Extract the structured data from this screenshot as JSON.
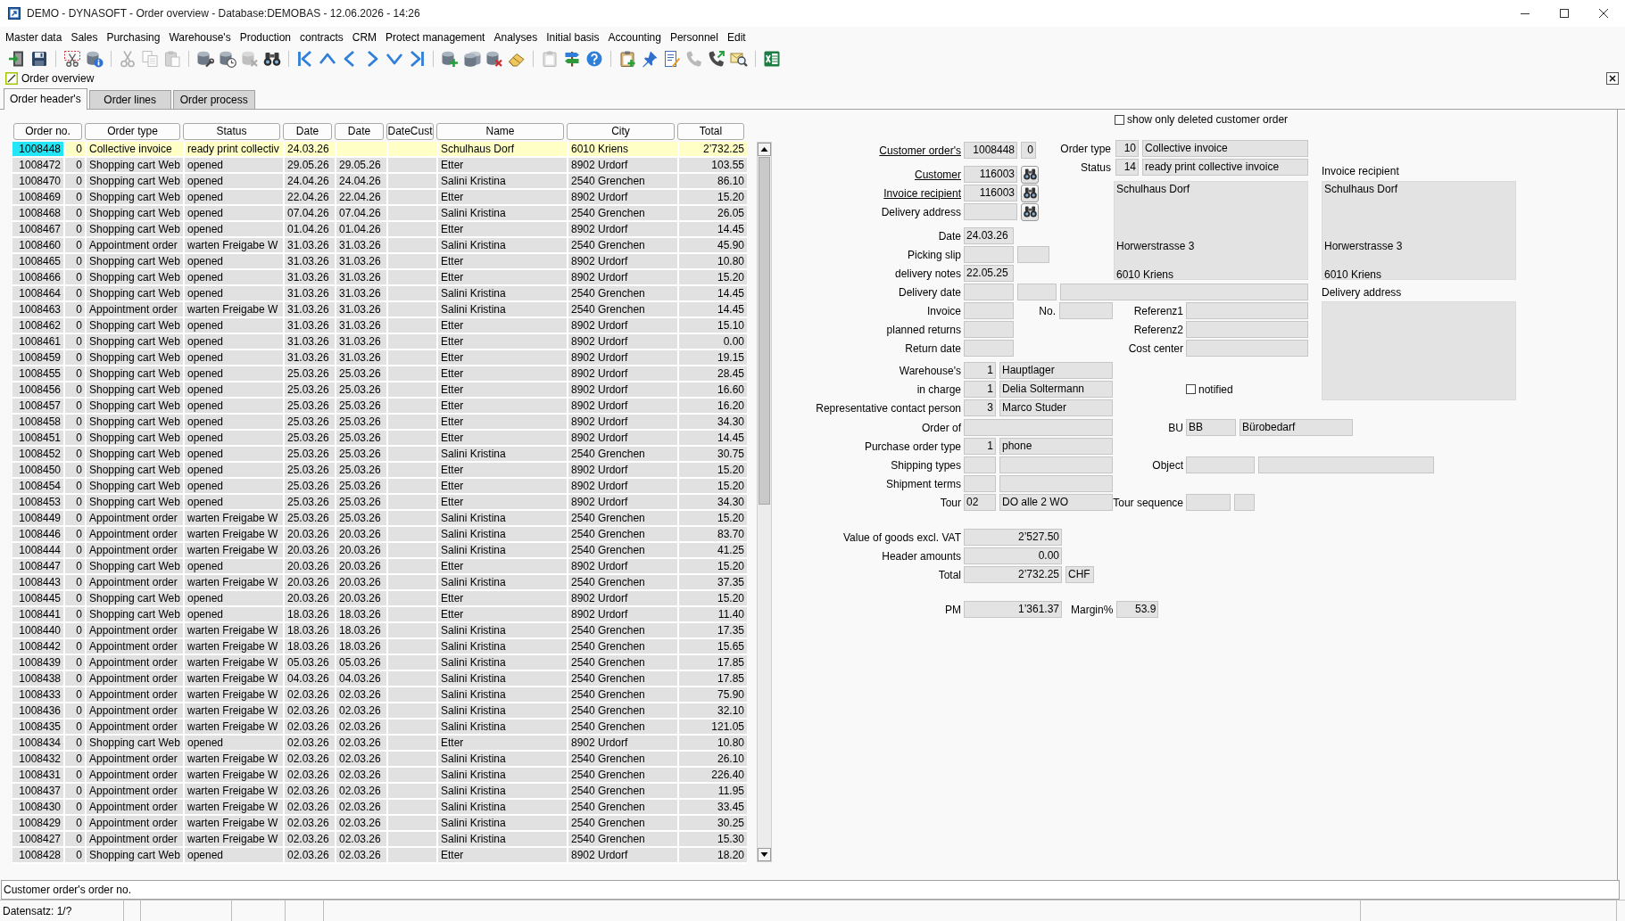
{
  "window": {
    "title": "DEMO - DYNASOFT - Order overview - Database:DEMOBAS - 12.06.2026 - 14:26"
  },
  "menu": [
    "Master data",
    "Sales",
    "Purchasing",
    "Warehouse's",
    "Production",
    "contracts",
    "CRM",
    "Protect management",
    "Analyses",
    "Initial basis",
    "Accounting",
    "Personnel",
    "Edit"
  ],
  "toolbar": {
    "groups": [
      {
        "buttons": [
          {
            "kind": "exit",
            "disabled": false
          },
          {
            "kind": "save",
            "disabled": false
          }
        ]
      },
      {
        "buttons": [
          {
            "kind": "cutframe",
            "disabled": false
          },
          {
            "kind": "dbinfo",
            "disabled": false
          }
        ]
      },
      {
        "buttons": [
          {
            "kind": "cut",
            "disabled": true
          },
          {
            "kind": "copy",
            "disabled": true
          },
          {
            "kind": "paste",
            "disabled": true
          }
        ]
      },
      {
        "buttons": [
          {
            "kind": "dbtools",
            "disabled": false
          },
          {
            "kind": "dbclock",
            "disabled": false
          },
          {
            "kind": "dbdelete",
            "disabled": true
          },
          {
            "kind": "binoculars",
            "disabled": false
          }
        ]
      },
      {
        "buttons": [
          {
            "kind": "first",
            "disabled": false
          },
          {
            "kind": "up",
            "disabled": false
          },
          {
            "kind": "left",
            "disabled": false
          },
          {
            "kind": "right",
            "disabled": false
          },
          {
            "kind": "down",
            "disabled": false
          },
          {
            "kind": "last",
            "disabled": false
          }
        ]
      },
      {
        "buttons": [
          {
            "kind": "dbadd",
            "disabled": false
          },
          {
            "kind": "dbstack",
            "disabled": false
          },
          {
            "kind": "dbdelete",
            "disabled": false
          },
          {
            "kind": "eraser",
            "disabled": false
          }
        ]
      },
      {
        "buttons": [
          {
            "kind": "clipboard",
            "disabled": true
          },
          {
            "kind": "signpost",
            "disabled": false
          },
          {
            "kind": "help",
            "disabled": false
          }
        ]
      },
      {
        "buttons": [
          {
            "kind": "clipboardadd",
            "disabled": false
          },
          {
            "kind": "pin",
            "disabled": false
          },
          {
            "kind": "notepad",
            "disabled": false
          },
          {
            "kind": "phone",
            "disabled": true
          },
          {
            "kind": "call",
            "disabled": false
          },
          {
            "kind": "search",
            "disabled": false
          }
        ]
      },
      {
        "buttons": [
          {
            "kind": "spreadsheet",
            "disabled": false
          }
        ]
      }
    ]
  },
  "document": {
    "title": "Order overview"
  },
  "tabs": [
    {
      "label": "Order header's",
      "selected": true
    },
    {
      "label": "Order lines",
      "selected": false
    },
    {
      "label": "Order process",
      "selected": false
    }
  ],
  "table": {
    "columns": [
      "Order no.",
      "Order type",
      "Status",
      "Date",
      "Date",
      "DateCust",
      "Name",
      "City",
      "Total"
    ],
    "rows": [
      {
        "order_no": "1008448",
        "column_2": "0",
        "order_type": "Collective invoice",
        "status": "ready print collectiv",
        "date": "24.03.26",
        "name": "Schulhaus Dorf",
        "city": "6010 Kriens",
        "total": "2’732.25",
        "selected": true
      },
      {
        "order_no": "1008472",
        "column_2": "0",
        "order_type": "Shopping cart Web",
        "status": "opened",
        "date": "29.05.26",
        "date_2": "29.05.26",
        "name": "Etter",
        "city": "8902 Urdorf",
        "total": "103.55",
        "selected": false
      },
      {
        "order_no": "1008470",
        "column_2": "0",
        "order_type": "Shopping cart Web",
        "status": "opened",
        "date": "24.04.26",
        "date_2": "24.04.26",
        "name": "Salini Kristina",
        "city": "2540 Grenchen",
        "total": "86.10",
        "selected": false
      },
      {
        "order_no": "1008469",
        "column_2": "0",
        "order_type": "Shopping cart Web",
        "status": "opened",
        "date": "22.04.26",
        "date_2": "22.04.26",
        "name": "Etter",
        "city": "8902 Urdorf",
        "total": "15.20",
        "selected": false
      },
      {
        "order_no": "1008468",
        "column_2": "0",
        "order_type": "Shopping cart Web",
        "status": "opened",
        "date": "07.04.26",
        "date_2": "07.04.26",
        "name": "Salini Kristina",
        "city": "2540 Grenchen",
        "total": "26.05",
        "selected": false
      },
      {
        "order_no": "1008467",
        "column_2": "0",
        "order_type": "Shopping cart Web",
        "status": "opened",
        "date": "01.04.26",
        "date_2": "01.04.26",
        "name": "Etter",
        "city": "8902 Urdorf",
        "total": "14.45",
        "selected": false
      },
      {
        "order_no": "1008460",
        "column_2": "0",
        "order_type": "Appointment order",
        "status": "warten Freigabe W",
        "date": "31.03.26",
        "date_2": "31.03.26",
        "name": "Salini Kristina",
        "city": "2540 Grenchen",
        "total": "45.90",
        "selected": false
      },
      {
        "order_no": "1008465",
        "column_2": "0",
        "order_type": "Shopping cart Web",
        "status": "opened",
        "date": "31.03.26",
        "date_2": "31.03.26",
        "name": "Etter",
        "city": "8902 Urdorf",
        "total": "10.80",
        "selected": false
      },
      {
        "order_no": "1008466",
        "column_2": "0",
        "order_type": "Shopping cart Web",
        "status": "opened",
        "date": "31.03.26",
        "date_2": "31.03.26",
        "name": "Etter",
        "city": "8902 Urdorf",
        "total": "15.20",
        "selected": false
      },
      {
        "order_no": "1008464",
        "column_2": "0",
        "order_type": "Shopping cart Web",
        "status": "opened",
        "date": "31.03.26",
        "date_2": "31.03.26",
        "name": "Salini Kristina",
        "city": "2540 Grenchen",
        "total": "14.45",
        "selected": false
      },
      {
        "order_no": "1008463",
        "column_2": "0",
        "order_type": "Appointment order",
        "status": "warten Freigabe W",
        "date": "31.03.26",
        "date_2": "31.03.26",
        "name": "Salini Kristina",
        "city": "2540 Grenchen",
        "total": "14.45",
        "selected": false
      },
      {
        "order_no": "1008462",
        "column_2": "0",
        "order_type": "Shopping cart Web",
        "status": "opened",
        "date": "31.03.26",
        "date_2": "31.03.26",
        "name": "Etter",
        "city": "8902 Urdorf",
        "total": "15.10",
        "selected": false
      },
      {
        "order_no": "1008461",
        "column_2": "0",
        "order_type": "Shopping cart Web",
        "status": "opened",
        "date": "31.03.26",
        "date_2": "31.03.26",
        "name": "Etter",
        "city": "8902 Urdorf",
        "total": "0.00",
        "selected": false
      },
      {
        "order_no": "1008459",
        "column_2": "0",
        "order_type": "Shopping cart Web",
        "status": "opened",
        "date": "31.03.26",
        "date_2": "31.03.26",
        "name": "Etter",
        "city": "8902 Urdorf",
        "total": "19.15",
        "selected": false
      },
      {
        "order_no": "1008455",
        "column_2": "0",
        "order_type": "Shopping cart Web",
        "status": "opened",
        "date": "25.03.26",
        "date_2": "25.03.26",
        "name": "Etter",
        "city": "8902 Urdorf",
        "total": "28.45",
        "selected": false
      },
      {
        "order_no": "1008456",
        "column_2": "0",
        "order_type": "Shopping cart Web",
        "status": "opened",
        "date": "25.03.26",
        "date_2": "25.03.26",
        "name": "Etter",
        "city": "8902 Urdorf",
        "total": "16.60",
        "selected": false
      },
      {
        "order_no": "1008457",
        "column_2": "0",
        "order_type": "Shopping cart Web",
        "status": "opened",
        "date": "25.03.26",
        "date_2": "25.03.26",
        "name": "Etter",
        "city": "8902 Urdorf",
        "total": "16.20",
        "selected": false
      },
      {
        "order_no": "1008458",
        "column_2": "0",
        "order_type": "Shopping cart Web",
        "status": "opened",
        "date": "25.03.26",
        "date_2": "25.03.26",
        "name": "Etter",
        "city": "8902 Urdorf",
        "total": "34.30",
        "selected": false
      },
      {
        "order_no": "1008451",
        "column_2": "0",
        "order_type": "Shopping cart Web",
        "status": "opened",
        "date": "25.03.26",
        "date_2": "25.03.26",
        "name": "Etter",
        "city": "8902 Urdorf",
        "total": "14.45",
        "selected": false
      },
      {
        "order_no": "1008452",
        "column_2": "0",
        "order_type": "Shopping cart Web",
        "status": "opened",
        "date": "25.03.26",
        "date_2": "25.03.26",
        "name": "Salini Kristina",
        "city": "2540 Grenchen",
        "total": "30.75",
        "selected": false
      },
      {
        "order_no": "1008450",
        "column_2": "0",
        "order_type": "Shopping cart Web",
        "status": "opened",
        "date": "25.03.26",
        "date_2": "25.03.26",
        "name": "Etter",
        "city": "8902 Urdorf",
        "total": "15.20",
        "selected": false
      },
      {
        "order_no": "1008454",
        "column_2": "0",
        "order_type": "Shopping cart Web",
        "status": "opened",
        "date": "25.03.26",
        "date_2": "25.03.26",
        "name": "Etter",
        "city": "8902 Urdorf",
        "total": "15.20",
        "selected": false
      },
      {
        "order_no": "1008453",
        "column_2": "0",
        "order_type": "Shopping cart Web",
        "status": "opened",
        "date": "25.03.26",
        "date_2": "25.03.26",
        "name": "Etter",
        "city": "8902 Urdorf",
        "total": "34.30",
        "selected": false
      },
      {
        "order_no": "1008449",
        "column_2": "0",
        "order_type": "Appointment order",
        "status": "warten Freigabe W",
        "date": "25.03.26",
        "date_2": "25.03.26",
        "name": "Salini Kristina",
        "city": "2540 Grenchen",
        "total": "15.20",
        "selected": false
      },
      {
        "order_no": "1008446",
        "column_2": "0",
        "order_type": "Appointment order",
        "status": "warten Freigabe W",
        "date": "20.03.26",
        "date_2": "20.03.26",
        "name": "Salini Kristina",
        "city": "2540 Grenchen",
        "total": "83.70",
        "selected": false
      },
      {
        "order_no": "1008444",
        "column_2": "0",
        "order_type": "Appointment order",
        "status": "warten Freigabe W",
        "date": "20.03.26",
        "date_2": "20.03.26",
        "name": "Salini Kristina",
        "city": "2540 Grenchen",
        "total": "41.25",
        "selected": false
      },
      {
        "order_no": "1008447",
        "column_2": "0",
        "order_type": "Shopping cart Web",
        "status": "opened",
        "date": "20.03.26",
        "date_2": "20.03.26",
        "name": "Etter",
        "city": "8902 Urdorf",
        "total": "15.20",
        "selected": false
      },
      {
        "order_no": "1008443",
        "column_2": "0",
        "order_type": "Appointment order",
        "status": "warten Freigabe W",
        "date": "20.03.26",
        "date_2": "20.03.26",
        "name": "Salini Kristina",
        "city": "2540 Grenchen",
        "total": "37.35",
        "selected": false
      },
      {
        "order_no": "1008445",
        "column_2": "0",
        "order_type": "Shopping cart Web",
        "status": "opened",
        "date": "20.03.26",
        "date_2": "20.03.26",
        "name": "Etter",
        "city": "8902 Urdorf",
        "total": "15.20",
        "selected": false
      },
      {
        "order_no": "1008441",
        "column_2": "0",
        "order_type": "Shopping cart Web",
        "status": "opened",
        "date": "18.03.26",
        "date_2": "18.03.26",
        "name": "Etter",
        "city": "8902 Urdorf",
        "total": "11.40",
        "selected": false
      },
      {
        "order_no": "1008440",
        "column_2": "0",
        "order_type": "Appointment order",
        "status": "warten Freigabe W",
        "date": "18.03.26",
        "date_2": "18.03.26",
        "name": "Salini Kristina",
        "city": "2540 Grenchen",
        "total": "17.35",
        "selected": false
      },
      {
        "order_no": "1008442",
        "column_2": "0",
        "order_type": "Appointment order",
        "status": "warten Freigabe W",
        "date": "18.03.26",
        "date_2": "18.03.26",
        "name": "Salini Kristina",
        "city": "2540 Grenchen",
        "total": "15.65",
        "selected": false
      },
      {
        "order_no": "1008439",
        "column_2": "0",
        "order_type": "Appointment order",
        "status": "warten Freigabe W",
        "date": "05.03.26",
        "date_2": "05.03.26",
        "name": "Salini Kristina",
        "city": "2540 Grenchen",
        "total": "17.85",
        "selected": false
      },
      {
        "order_no": "1008438",
        "column_2": "0",
        "order_type": "Appointment order",
        "status": "warten Freigabe W",
        "date": "04.03.26",
        "date_2": "04.03.26",
        "name": "Salini Kristina",
        "city": "2540 Grenchen",
        "total": "17.85",
        "selected": false
      },
      {
        "order_no": "1008433",
        "column_2": "0",
        "order_type": "Appointment order",
        "status": "warten Freigabe W",
        "date": "02.03.26",
        "date_2": "02.03.26",
        "name": "Salini Kristina",
        "city": "2540 Grenchen",
        "total": "75.90",
        "selected": false
      },
      {
        "order_no": "1008436",
        "column_2": "0",
        "order_type": "Appointment order",
        "status": "warten Freigabe W",
        "date": "02.03.26",
        "date_2": "02.03.26",
        "name": "Salini Kristina",
        "city": "2540 Grenchen",
        "total": "32.10",
        "selected": false
      },
      {
        "order_no": "1008435",
        "column_2": "0",
        "order_type": "Appointment order",
        "status": "warten Freigabe W",
        "date": "02.03.26",
        "date_2": "02.03.26",
        "name": "Salini Kristina",
        "city": "2540 Grenchen",
        "total": "121.05",
        "selected": false
      },
      {
        "order_no": "1008434",
        "column_2": "0",
        "order_type": "Shopping cart Web",
        "status": "opened",
        "date": "02.03.26",
        "date_2": "02.03.26",
        "name": "Etter",
        "city": "8902 Urdorf",
        "total": "10.80",
        "selected": false
      },
      {
        "order_no": "1008432",
        "column_2": "0",
        "order_type": "Appointment order",
        "status": "warten Freigabe W",
        "date": "02.03.26",
        "date_2": "02.03.26",
        "name": "Salini Kristina",
        "city": "2540 Grenchen",
        "total": "26.10",
        "selected": false
      },
      {
        "order_no": "1008431",
        "column_2": "0",
        "order_type": "Appointment order",
        "status": "warten Freigabe W",
        "date": "02.03.26",
        "date_2": "02.03.26",
        "name": "Salini Kristina",
        "city": "2540 Grenchen",
        "total": "226.40",
        "selected": false
      },
      {
        "order_no": "1008437",
        "column_2": "0",
        "order_type": "Appointment order",
        "status": "warten Freigabe W",
        "date": "02.03.26",
        "date_2": "02.03.26",
        "name": "Salini Kristina",
        "city": "2540 Grenchen",
        "total": "11.95",
        "selected": false
      },
      {
        "order_no": "1008430",
        "column_2": "0",
        "order_type": "Appointment order",
        "status": "warten Freigabe W",
        "date": "02.03.26",
        "date_2": "02.03.26",
        "name": "Salini Kristina",
        "city": "2540 Grenchen",
        "total": "33.45",
        "selected": false
      },
      {
        "order_no": "1008429",
        "column_2": "0",
        "order_type": "Appointment order",
        "status": "warten Freigabe W",
        "date": "02.03.26",
        "date_2": "02.03.26",
        "name": "Salini Kristina",
        "city": "2540 Grenchen",
        "total": "30.25",
        "selected": false
      },
      {
        "order_no": "1008427",
        "column_2": "0",
        "order_type": "Appointment order",
        "status": "warten Freigabe W",
        "date": "02.03.26",
        "date_2": "02.03.26",
        "name": "Salini Kristina",
        "city": "2540 Grenchen",
        "total": "15.30",
        "selected": false
      },
      {
        "order_no": "1008428",
        "column_2": "0",
        "order_type": "Shopping cart Web",
        "status": "opened",
        "date": "02.03.26",
        "date_2": "02.03.26",
        "name": "Etter",
        "city": "8902 Urdorf",
        "total": "18.20",
        "selected": false
      }
    ]
  },
  "form": {
    "filter": {
      "label": "show only deleted customer order",
      "checked": false
    },
    "head_groups": [
      [
        {
          "label": "Customer order's",
          "link": true,
          "controls": [
            {
              "kind": "number",
              "value": "1008448"
            },
            {
              "kind": "flag",
              "value": "0"
            }
          ]
        }
      ],
      [
        {
          "label": "Customer",
          "link": true,
          "controls": [
            {
              "kind": "number",
              "value": "116003"
            },
            {
              "kind": "lookup"
            }
          ]
        },
        {
          "label": "Invoice recipient",
          "link": true,
          "controls": [
            {
              "kind": "number",
              "value": "116003"
            },
            {
              "kind": "lookup"
            }
          ]
        },
        {
          "label": "Delivery address",
          "link": false,
          "controls": [
            {
              "kind": "number"
            },
            {
              "kind": "lookup"
            }
          ]
        }
      ],
      [
        {
          "label": "Date",
          "link": false,
          "controls": [
            {
              "kind": "date",
              "value": "24.03.26"
            }
          ]
        },
        {
          "label": "Picking slip",
          "link": false,
          "controls": [
            {
              "kind": "date"
            },
            {
              "kind": "short"
            }
          ]
        },
        {
          "label": "delivery notes",
          "link": false,
          "controls": [
            {
              "kind": "date",
              "value": "22.05.25"
            }
          ]
        }
      ]
    ],
    "type_rows": [
      {
        "label": "Order type",
        "link": false,
        "controls": [
          {
            "kind": "code",
            "value": "10"
          },
          {
            "kind": "text",
            "value": "Collective invoice"
          }
        ]
      },
      {
        "label": "Status",
        "link": false,
        "controls": [
          {
            "kind": "code",
            "value": "14"
          },
          {
            "kind": "text",
            "value": "ready print collective invoice"
          }
        ]
      }
    ],
    "customer_address": "Schulhaus Dorf\n\n\n\nHorwerstrasse 3\n\n6010 Kriens",
    "detail_groups": [
      [
        {
          "label": "Delivery date",
          "link": false,
          "controls": [
            {
              "kind": "date"
            },
            {
              "kind": "medium"
            },
            {
              "kind": "wide"
            }
          ]
        },
        {
          "label": "Invoice",
          "link": false,
          "controls": [
            {
              "kind": "date"
            },
            {
              "kind": "caption",
              "text": "No."
            },
            {
              "kind": "number"
            }
          ],
          "aside": {
            "label": "Referenz1",
            "controls": [
              {
                "kind": "reference"
              }
            ]
          }
        },
        {
          "label": "planned returns",
          "link": false,
          "controls": [
            {
              "kind": "date"
            }
          ],
          "aside": {
            "label": "Referenz2",
            "controls": [
              {
                "kind": "reference"
              }
            ]
          }
        },
        {
          "label": "Return date",
          "link": false,
          "controls": [
            {
              "kind": "date"
            }
          ],
          "aside": {
            "label": "Cost center",
            "controls": [
              {
                "kind": "reference"
              }
            ]
          }
        }
      ],
      [
        {
          "label": "Warehouse's",
          "link": false,
          "controls": [
            {
              "kind": "code",
              "value": "1"
            },
            {
              "kind": "name",
              "value": "Hauptlager"
            }
          ]
        },
        {
          "label": "in charge",
          "link": false,
          "controls": [
            {
              "kind": "code",
              "value": "1"
            },
            {
              "kind": "name",
              "value": "Delia Soltermann"
            }
          ],
          "aside": {
            "controls": [
              {
                "kind": "checkbox",
                "label": "notified",
                "checked": false
              }
            ]
          }
        },
        {
          "label": "Representative contact person",
          "link": false,
          "controls": [
            {
              "kind": "code",
              "value": "3"
            },
            {
              "kind": "name",
              "value": "Marco Studer"
            }
          ]
        }
      ]
    ],
    "lower_groups": [
      [
        {
          "label": "Order of",
          "link": false,
          "controls": [
            {
              "kind": "long"
            }
          ],
          "aside": {
            "label": "BU",
            "controls": [
              {
                "kind": "unit",
                "value": "BB"
              },
              {
                "kind": "name",
                "value": "Bürobedarf"
              }
            ]
          }
        },
        {
          "label": "Purchase order type",
          "link": false,
          "controls": [
            {
              "kind": "code",
              "value": "1"
            },
            {
              "kind": "name",
              "value": "phone"
            }
          ]
        },
        {
          "label": "Shipping types",
          "link": false,
          "controls": [
            {
              "kind": "code"
            },
            {
              "kind": "name"
            }
          ],
          "aside": {
            "label": "Object",
            "controls": [
              {
                "kind": "object"
              },
              {
                "kind": "description"
              }
            ]
          }
        },
        {
          "label": "Shipment terms",
          "link": false,
          "controls": [
            {
              "kind": "code"
            },
            {
              "kind": "name"
            }
          ]
        },
        {
          "label": "Tour",
          "link": false,
          "controls": [
            {
              "kind": "key",
              "value": "02"
            },
            {
              "kind": "name",
              "value": "DO alle 2 WO"
            }
          ],
          "aside": {
            "label": "Tour sequence",
            "controls": [
              {
                "kind": "sequence"
              },
              {
                "kind": "tiny"
              }
            ]
          }
        }
      ],
      [
        {
          "label": "Value of goods excl. VAT",
          "link": false,
          "controls": [
            {
              "kind": "amount",
              "value": "2’527.50"
            }
          ]
        },
        {
          "label": "Header amounts",
          "link": false,
          "controls": [
            {
              "kind": "amount",
              "value": "0.00"
            }
          ]
        },
        {
          "label": "Total",
          "link": false,
          "controls": [
            {
              "kind": "amount",
              "value": "2’732.25"
            },
            {
              "kind": "currency",
              "value": "CHF"
            }
          ]
        }
      ],
      [
        {
          "label": "PM",
          "link": false,
          "controls": [
            {
              "kind": "amount",
              "value": "1’361.37"
            },
            {
              "kind": "caption",
              "text": "Margin%"
            },
            {
              "kind": "percent",
              "value": "53.9"
            }
          ]
        }
      ]
    ],
    "invoice_recipient": {
      "label": "Invoice recipient",
      "address": "Schulhaus Dorf\n\n\n\nHorwerstrasse 3\n\n6010 Kriens"
    },
    "delivery_address": {
      "label": "Delivery address"
    }
  },
  "status_bar": {
    "hint": "Customer order's order no.",
    "record": "Datensatz: 1/?"
  }
}
